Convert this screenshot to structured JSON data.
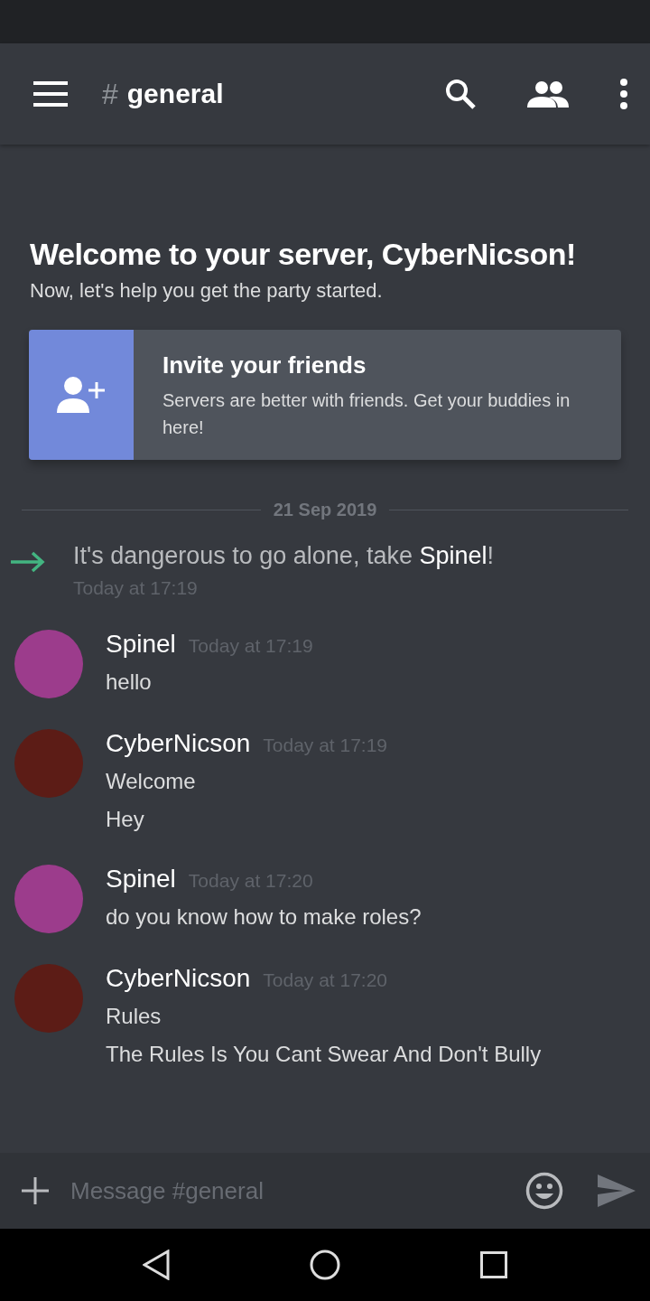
{
  "app_bar": {
    "channel_hash": "#",
    "channel_name": "general"
  },
  "welcome": {
    "title": "Welcome to your server, CyberNicson!",
    "subtitle": "Now, let's help you get the party started."
  },
  "invite_card": {
    "title": "Invite your friends",
    "text": "Servers are better with friends. Get your buddies in here!"
  },
  "date_divider": "21 Sep 2019",
  "join_message": {
    "text": "It's dangerous to go alone, take **Spinel**!",
    "time": "Today at 17:19"
  },
  "messages": [
    {
      "author": "Spinel",
      "time": "Today at 17:19",
      "color": "#9c3c8c",
      "lines": [
        "hello"
      ]
    },
    {
      "author": "CyberNicson",
      "time": "Today at 17:19",
      "color": "#5c1c16",
      "lines": [
        "Welcome",
        "Hey"
      ]
    },
    {
      "author": "Spinel",
      "time": "Today at 17:20",
      "color": "#9c3c8c",
      "lines": [
        "do you know how to make roles?"
      ]
    },
    {
      "author": "CyberNicson",
      "time": "Today at 17:20",
      "color": "#5c1c16",
      "lines": [
        "Rules",
        "The Rules Is You Cant Swear And Don't Bully"
      ]
    }
  ],
  "composer": {
    "placeholder": "Message #general"
  }
}
